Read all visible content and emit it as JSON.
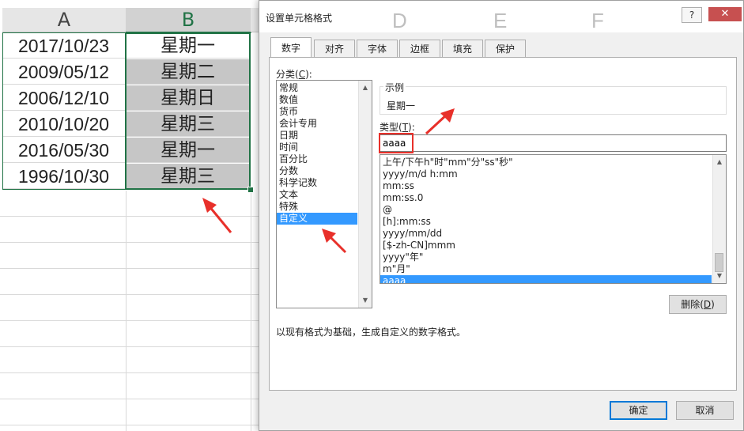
{
  "spreadsheet": {
    "columns": [
      "A",
      "B"
    ],
    "background_columns": [
      "D",
      "E",
      "F"
    ],
    "rows": [
      {
        "date": "2017/10/23",
        "weekday": "星期一"
      },
      {
        "date": "2009/05/12",
        "weekday": "星期二"
      },
      {
        "date": "2006/12/10",
        "weekday": "星期日"
      },
      {
        "date": "2010/10/20",
        "weekday": "星期三"
      },
      {
        "date": "2016/05/30",
        "weekday": "星期一"
      },
      {
        "date": "1996/10/30",
        "weekday": "星期三"
      }
    ]
  },
  "dialog": {
    "title": "设置单元格格式",
    "help": "?",
    "close": "✕",
    "tabs": [
      "数字",
      "对齐",
      "字体",
      "边框",
      "填充",
      "保护"
    ],
    "active_tab": "数字",
    "category_label": "分类(C):",
    "category_label_parts": {
      "pre": "分类(",
      "key": "C",
      "post": "):"
    },
    "categories": [
      "常规",
      "数值",
      "货币",
      "会计专用",
      "日期",
      "时间",
      "百分比",
      "分数",
      "科学记数",
      "文本",
      "特殊",
      "自定义"
    ],
    "selected_category": "自定义",
    "sample_label": "示例",
    "sample_value": "星期一",
    "type_label_parts": {
      "pre": "类型(",
      "key": "T",
      "post": "):"
    },
    "type_value": "aaaa",
    "formats": [
      "上午/下午h\"时\"mm\"分\"ss\"秒\"",
      "yyyy/m/d h:mm",
      "mm:ss",
      "mm:ss.0",
      "@",
      "[h]:mm:ss",
      "yyyy/mm/dd",
      "[$-zh-CN]mmm",
      "yyyy\"年\"",
      "m\"月\"",
      "aaaa"
    ],
    "selected_format": "aaaa",
    "delete_button_parts": {
      "pre": "删除(",
      "key": "D",
      "post": ")"
    },
    "description": "以现有格式为基础，生成自定义的数字格式。",
    "ok_button": "确定",
    "cancel_button": "取消"
  },
  "colors": {
    "excel_green": "#217346",
    "selection_blue": "#3399ff",
    "annotation_red": "#e8302a",
    "selected_cell_gray": "#c6c6c6"
  }
}
